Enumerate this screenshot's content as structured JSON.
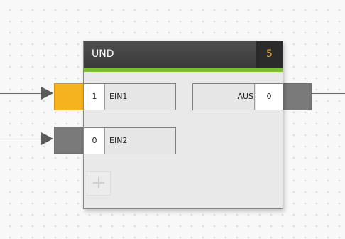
{
  "block": {
    "title": "UND",
    "number": "5"
  },
  "inputs": [
    {
      "value": "1",
      "label": "EIN1",
      "port_color": "#f5b41e"
    },
    {
      "value": "0",
      "label": "EIN2",
      "port_color": "#7a7a7a"
    }
  ],
  "output": {
    "label": "AUS",
    "value": "0",
    "port_color": "#7a7a7a"
  },
  "add_button": {
    "icon": "plus-icon",
    "symbol": "+"
  },
  "colors": {
    "header": "#3f3f3f",
    "accent_bar": "#7ac232",
    "number": "#f2a623"
  }
}
